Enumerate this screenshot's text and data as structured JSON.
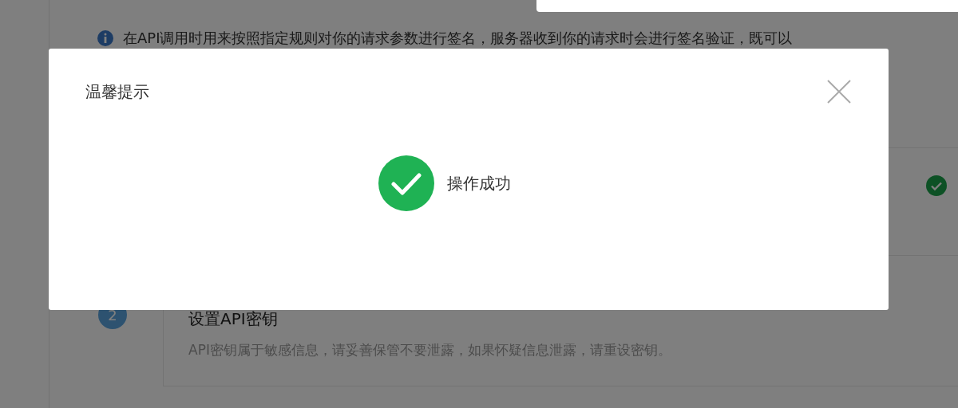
{
  "notice": {
    "text": "在API调用时用来按照指定规则对你的请求参数进行签名，服务器收到你的请求时会进行签名验证，既可以"
  },
  "steps": [
    {
      "number": "2",
      "title": "设置API密钥",
      "description": "API密钥属于敏感信息，请妥善保管不要泄露，如果怀疑信息泄露，请重设密钥。"
    }
  ],
  "modal": {
    "title": "温馨提示",
    "message": "操作成功"
  }
}
